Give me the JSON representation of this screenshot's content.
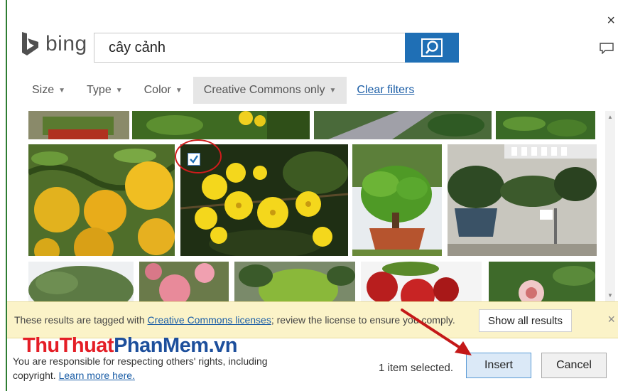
{
  "header": {
    "close_symbol": "×",
    "feedback_icon": "speech-bubble-icon"
  },
  "brand": {
    "name": "bing",
    "logo_icon": "bing-logo-icon",
    "color": "#505050"
  },
  "search": {
    "value": "cây cảnh",
    "button_icon": "search-icon",
    "button_color": "#1f6fb5"
  },
  "filters": {
    "items": [
      {
        "label": "Size"
      },
      {
        "label": "Type"
      },
      {
        "label": "Color"
      },
      {
        "label": "Creative Commons only"
      }
    ],
    "clear_label": "Clear filters"
  },
  "results": {
    "tiles": [
      {
        "name": "bonsai-pot-thumb"
      },
      {
        "name": "yellow-flower-leaves-thumb"
      },
      {
        "name": "garden-path-thumb"
      },
      {
        "name": "green-leaves-thumb"
      },
      {
        "name": "orange-fruit-tree-thumb"
      },
      {
        "name": "yellow-apricot-blossom-thumb",
        "selected": true
      },
      {
        "name": "bonsai-tree-pot-thumb"
      },
      {
        "name": "bonsai-display-thumb"
      },
      {
        "name": "shrub-thumb"
      },
      {
        "name": "pink-roses-thumb"
      },
      {
        "name": "pine-bonsai-thumb"
      },
      {
        "name": "red-fruit-thumb"
      },
      {
        "name": "pink-flower-thumb"
      }
    ]
  },
  "notice": {
    "text_before": "These results are tagged with ",
    "link": "Creative Commons licenses",
    "text_after": "; review the license to ensure you comply.",
    "show_all_label": "Show all results",
    "close_symbol": "×",
    "bg_color": "#fbf3c8"
  },
  "watermark": {
    "part1": "ThuThuat",
    "part2": "PhanMem",
    "part3": ".vn"
  },
  "footer": {
    "text": "You are responsible for respecting others' rights, including copyright.",
    "learn_more": "Learn more here.",
    "selected_count": "1 item selected.",
    "insert_label": "Insert",
    "cancel_label": "Cancel"
  }
}
